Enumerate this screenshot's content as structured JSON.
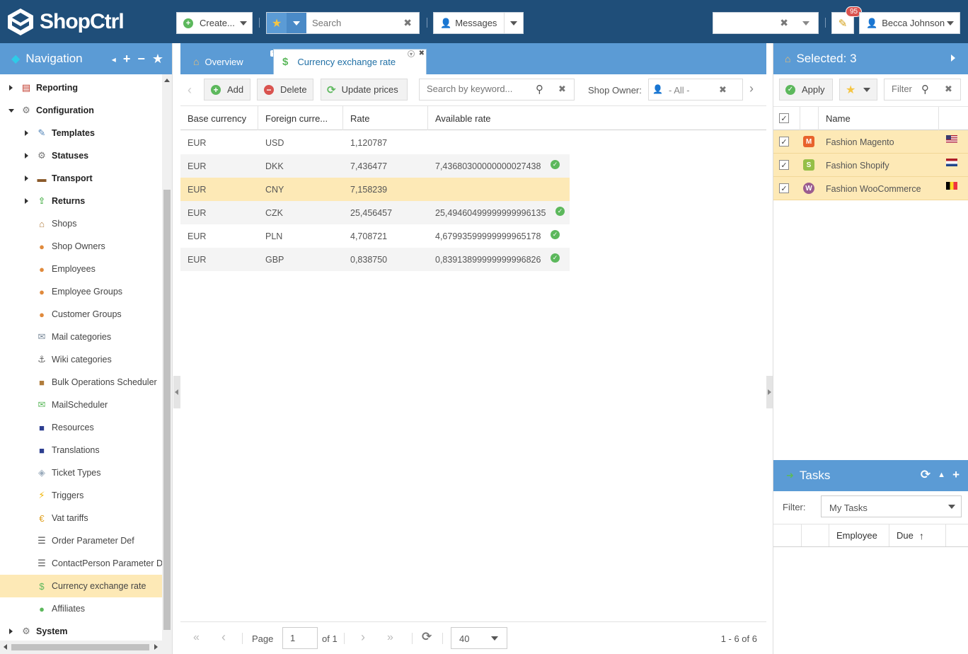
{
  "app": {
    "logo_text": "ShopCtrl"
  },
  "topbar": {
    "create_label": "Create...",
    "search_placeholder": "Search",
    "messages_label": "Messages",
    "notification_count": "95",
    "user_name": "Becca Johnson"
  },
  "nav": {
    "title": "Navigation",
    "items": [
      {
        "label": "Reporting",
        "bold": true
      },
      {
        "label": "Configuration",
        "bold": true
      },
      {
        "label": "Templates",
        "bold": true
      },
      {
        "label": "Statuses",
        "bold": true
      },
      {
        "label": "Transport",
        "bold": true
      },
      {
        "label": "Returns",
        "bold": true
      },
      {
        "label": "Shops"
      },
      {
        "label": "Shop Owners"
      },
      {
        "label": "Employees"
      },
      {
        "label": "Employee Groups"
      },
      {
        "label": "Customer Groups"
      },
      {
        "label": "Mail categories"
      },
      {
        "label": "Wiki categories"
      },
      {
        "label": "Bulk Operations Scheduler"
      },
      {
        "label": "MailScheduler"
      },
      {
        "label": "Resources"
      },
      {
        "label": "Translations"
      },
      {
        "label": "Ticket Types"
      },
      {
        "label": "Triggers"
      },
      {
        "label": "Vat tariffs"
      },
      {
        "label": "Order Parameter Def"
      },
      {
        "label": "ContactPerson Parameter Def"
      },
      {
        "label": "Currency exchange rate",
        "selected": true
      },
      {
        "label": "Affiliates"
      },
      {
        "label": "System",
        "bold": true
      }
    ]
  },
  "tabs": [
    {
      "label": "Overview"
    },
    {
      "label": "Currency exchange rate"
    }
  ],
  "toolbar": {
    "add_label": "Add",
    "delete_label": "Delete",
    "update_label": "Update prices",
    "search_placeholder": "Search by keyword...",
    "shop_owner_label": "Shop Owner:",
    "shop_owner_value": "- All -"
  },
  "grid": {
    "columns": [
      "Base currency",
      "Foreign curre...",
      "Rate",
      "Available rate"
    ],
    "rows": [
      {
        "base": "EUR",
        "foreign": "USD",
        "rate": "1,120787",
        "available": ""
      },
      {
        "base": "EUR",
        "foreign": "DKK",
        "rate": "7,436477",
        "available": "7,43680300000000027438"
      },
      {
        "base": "EUR",
        "foreign": "CNY",
        "rate": "7,158239",
        "available": ""
      },
      {
        "base": "EUR",
        "foreign": "CZK",
        "rate": "25,456457",
        "available": "25,49460499999999996135"
      },
      {
        "base": "EUR",
        "foreign": "PLN",
        "rate": "4,708721",
        "available": "4,67993599999999965178"
      },
      {
        "base": "EUR",
        "foreign": "GBP",
        "rate": "0,838750",
        "available": "0,83913899999999996826"
      }
    ]
  },
  "pager": {
    "page_label": "Page",
    "page_value": "1",
    "of_label": "of 1",
    "page_size": "40",
    "summary": "1 - 6 of 6"
  },
  "selected": {
    "title": "Selected: 3",
    "apply_label": "Apply",
    "filter_placeholder": "Filter",
    "name_column": "Name",
    "shops": [
      {
        "name": "Fashion Magento"
      },
      {
        "name": "Fashion Shopify"
      },
      {
        "name": "Fashion WooCommerce"
      }
    ]
  },
  "tasks": {
    "title": "Tasks",
    "filter_label": "Filter:",
    "filter_value": "My Tasks",
    "columns": [
      "Employee",
      "Due"
    ]
  }
}
